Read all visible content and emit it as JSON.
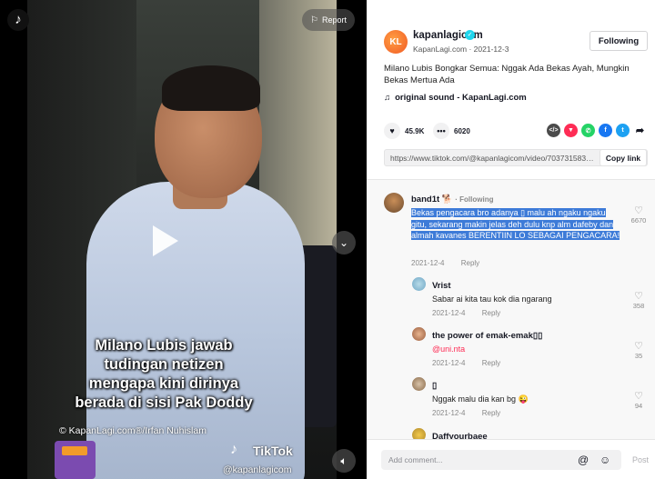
{
  "video": {
    "caption_lines": [
      "Milano Lubis jawab",
      "tudingan netizen",
      "mengapa kini dirinya",
      "berada di sisi Pak Doddy"
    ],
    "credit": "© KapanLagi.com®/Irfan Nuhislam",
    "watermark_name": "TikTok",
    "watermark_handle": "@kapanlagicom",
    "report_label": "Report"
  },
  "author": {
    "avatar_text": "KL",
    "username": "kapanlagicom",
    "nickname": "KapanLagi.com",
    "separator": "·",
    "date": "2021-12-3",
    "follow_label": "Following"
  },
  "post": {
    "description": "Milano Lubis Bongkar Semua: Nggak Ada Bekas Ayah, Mungkin Bekas Mertua Ada",
    "music": "original sound - KapanLagi.com",
    "likes": "45.9K",
    "comments": "6020",
    "link": "https://www.tiktok.com/@kapanlagicom/video/7037315833...",
    "copy_label": "Copy link"
  },
  "share_icons": [
    {
      "name": "embed-icon",
      "glyph": "</>",
      "color": "#4b4b4b"
    },
    {
      "name": "send-icon",
      "glyph": "▼",
      "color": "#fe2c55"
    },
    {
      "name": "whatsapp-icon",
      "glyph": "✆",
      "color": "#25d366"
    },
    {
      "name": "facebook-icon",
      "glyph": "f",
      "color": "#1877f2"
    },
    {
      "name": "twitter-icon",
      "glyph": "t",
      "color": "#1da1f2"
    },
    {
      "name": "more-share-icon",
      "glyph": "➦",
      "color": "#161823"
    }
  ],
  "comments": [
    {
      "user": "band1t",
      "user_suffix": "🐕",
      "tag": "· Following",
      "text": "Bekas pengacara bro adanya ▯ malu ah ngaku ngaku gitu, sekarang makin jelas deh dulu knp alm dafeby dan almah kavanes BERENTIIN LO SEBAGAI PENGACARA!",
      "date": "2021-12-4",
      "reply": "Reply",
      "likes": "6670"
    },
    {
      "user": "Vrist",
      "text": "Sabar ai kita tau kok dia ngarang",
      "date": "2021-12-4",
      "reply": "Reply",
      "likes": "358"
    },
    {
      "user": "the power of emak-emak▯▯",
      "text": "@uni.nta",
      "date": "2021-12-4",
      "reply": "Reply",
      "likes": "35"
    },
    {
      "user": "▯",
      "text": "Nggak malu dia kan bg 😜",
      "date": "2021-12-4",
      "reply": "Reply",
      "likes": "94"
    },
    {
      "user": "Daffyourbaee",
      "text": "",
      "date": "",
      "reply": "",
      "likes": ""
    }
  ],
  "comment_bar": {
    "placeholder": "Add comment...",
    "post_label": "Post"
  }
}
